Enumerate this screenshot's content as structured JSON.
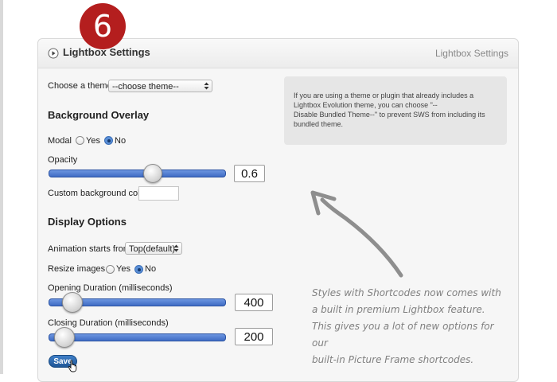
{
  "step_badge": "6",
  "panel": {
    "title": "Lightbox Settings",
    "title_right": "Lightbox Settings"
  },
  "theme": {
    "label": "Choose a theme",
    "selected": "--choose theme--"
  },
  "info_box": {
    "lines": [
      "If you are using a theme or plugin that already includes a",
      "Lightbox Evolution theme, you can choose \"--",
      "Disable Bundled Theme--\" to prevent SWS from including its",
      "bundled theme."
    ]
  },
  "background_overlay": {
    "title": "Background Overlay",
    "modal_label": "Modal",
    "yes_label": "Yes",
    "no_label": "No",
    "modal_selected": "No",
    "opacity_label": "Opacity",
    "opacity_value": "0.6",
    "opacity_fraction": 0.6,
    "custom_color_label": "Custom background color",
    "custom_color_value": ""
  },
  "display_options": {
    "title": "Display Options",
    "animation_label": "Animation starts from",
    "animation_selected": "Top(default)",
    "resize_label": "Resize images",
    "yes_label": "Yes",
    "no_label": "No",
    "resize_selected": "No",
    "opening_label": "Opening Duration (milliseconds)",
    "opening_value": "400",
    "opening_fraction": 0.1,
    "closing_label": "Closing Duration (milliseconds)",
    "closing_value": "200",
    "closing_fraction": 0.05
  },
  "save_label": "Save",
  "annotation": {
    "lines": [
      "Styles with Shortcodes now comes with",
      "a built in premium Lightbox feature.",
      "This gives you a lot of new options for our",
      "built-in Picture Frame shortcodes."
    ]
  },
  "colors": {
    "badge": "#b41e1e",
    "slider": "#4a78cf",
    "save_button": "#2a66ad"
  }
}
